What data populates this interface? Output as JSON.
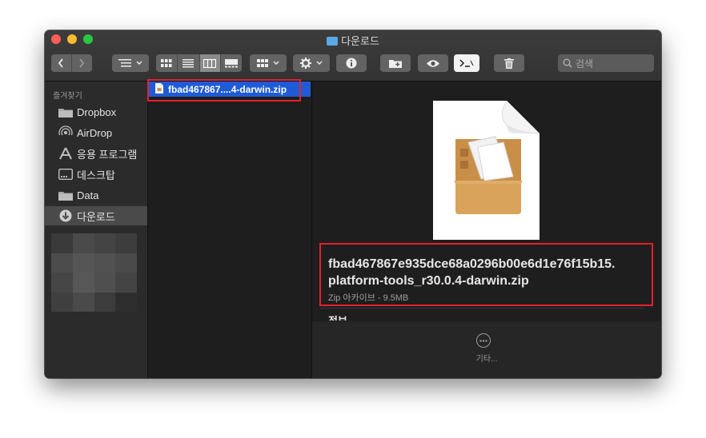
{
  "window": {
    "title": "다운로드"
  },
  "toolbar": {
    "back": "back-arrow",
    "forward": "forward-arrow",
    "search_placeholder": "검색"
  },
  "sidebar": {
    "heading": "즐겨찾기",
    "items": [
      {
        "label": "Dropbox",
        "icon": "folder-icon"
      },
      {
        "label": "AirDrop",
        "icon": "airdrop-icon"
      },
      {
        "label": "응용 프로그램",
        "icon": "applications-icon"
      },
      {
        "label": "데스크탑",
        "icon": "desktop-icon"
      },
      {
        "label": "Data",
        "icon": "folder-icon"
      },
      {
        "label": "다운로드",
        "icon": "download-icon",
        "selected": true
      }
    ]
  },
  "column": {
    "selected_file": "fbad467867....4-darwin.zip"
  },
  "preview": {
    "filename_line1": "fbad467867e935dce68a0296b00e6d1e76f15b15.",
    "filename_line2": "platform-tools_r30.0.4-darwin.zip",
    "meta": "Zip 아카이브 - 9.5MB",
    "info_heading": "정보",
    "more_label": "기타..."
  },
  "colors": {
    "selection": "#1f5bd6",
    "highlight_box": "#e4202b"
  }
}
